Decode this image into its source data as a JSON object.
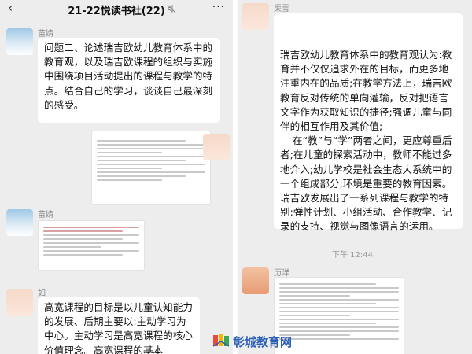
{
  "left": {
    "header": {
      "back": "‹",
      "title": "21-22悦读书社(22)",
      "more": "···"
    },
    "messages": [
      {
        "sender": "苗婧",
        "text": "问题二、论述瑞吉欧幼儿教育体系中的教育观，以及瑞吉欧课程的组织与实施中围绕项目活动提出的课程与教学的特点。结合自己的学习，谈谈自己最深刻的感受。"
      },
      {
        "sender": "苗婧"
      },
      {
        "sender": "如",
        "text": "高宽课程的目标是以儿童认知能力的发展、后期主要以:主动学习为中心。主动学习是高宽课程的核心价值理念。高宽课程的基本"
      }
    ]
  },
  "right": {
    "messages": [
      {
        "sender": "渠雪",
        "text": "瑞吉欧幼儿教育体系中的教育观认为:教育并不仅仅追求外在的目标，而更多地注重内在的品质;在教学方法上，瑞吉欧教育反对传统的单向灌输，反对把语言文字作为获取知识的捷径;强调儿童与同伴的相互作用及其价值;\n    在“教”与“学”两者之间，更应尊重后者;在儿童的探索活动中，教师不能过多地介入;幼儿学校是社会生态大系统中的一个组成部分;环境是重要的教育因素。瑞吉欧发展出了一系列课程与教学的特别:弹性计划、小组活动、合作教学、记录的支持、视觉与图像语言的运用。"
      },
      {
        "sender": "历洋"
      }
    ],
    "time": "下午 12:44"
  },
  "watermark": {
    "brand": "彰城教育网"
  },
  "colors": {
    "bg": "#ededed",
    "bubble": "#ffffff",
    "name": "#8a8a8a",
    "brand": "#2a5fb5"
  },
  "icons": [
    "back-icon",
    "mute-icon",
    "more-icon",
    "avatar",
    "logo-icon"
  ]
}
